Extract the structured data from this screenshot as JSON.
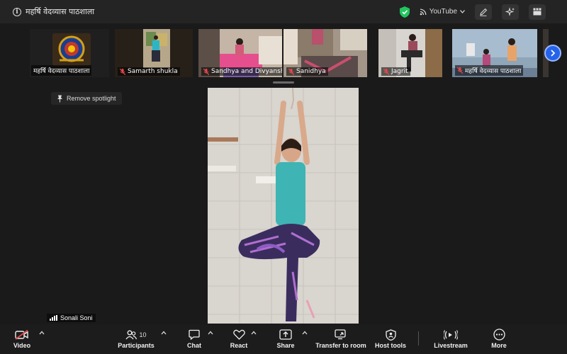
{
  "window": {
    "title": "महर्षि वेदव्यास पाठशाला"
  },
  "header": {
    "youtube_label": "YouTube"
  },
  "strip": {
    "tiles": [
      {
        "name": "महर्षि वेदव्यास पाठशाला",
        "muted": false
      },
      {
        "name": "Samarth shukla",
        "muted": true
      },
      {
        "name": "Sandhya and Divyanshi",
        "muted": true
      },
      {
        "name": "Sanidhya",
        "muted": true
      },
      {
        "name": "Jagrit",
        "muted": true
      },
      {
        "name": "महर्षि वेदव्यास पाठशाला",
        "muted": true
      }
    ]
  },
  "spotlight": {
    "remove_label": "Remove spotlight"
  },
  "main": {
    "speaker_name": "Sonali Soni"
  },
  "toolbar": {
    "video": "Video",
    "participants": "Participants",
    "participants_count": "10",
    "chat": "Chat",
    "react": "React",
    "share": "Share",
    "transfer": "Transfer to room",
    "host_tools": "Host tools",
    "livestream": "Livestream",
    "more": "More"
  },
  "colors": {
    "accent": "#2563eb",
    "shield": "#22c55e",
    "muted": "#e5484d"
  }
}
